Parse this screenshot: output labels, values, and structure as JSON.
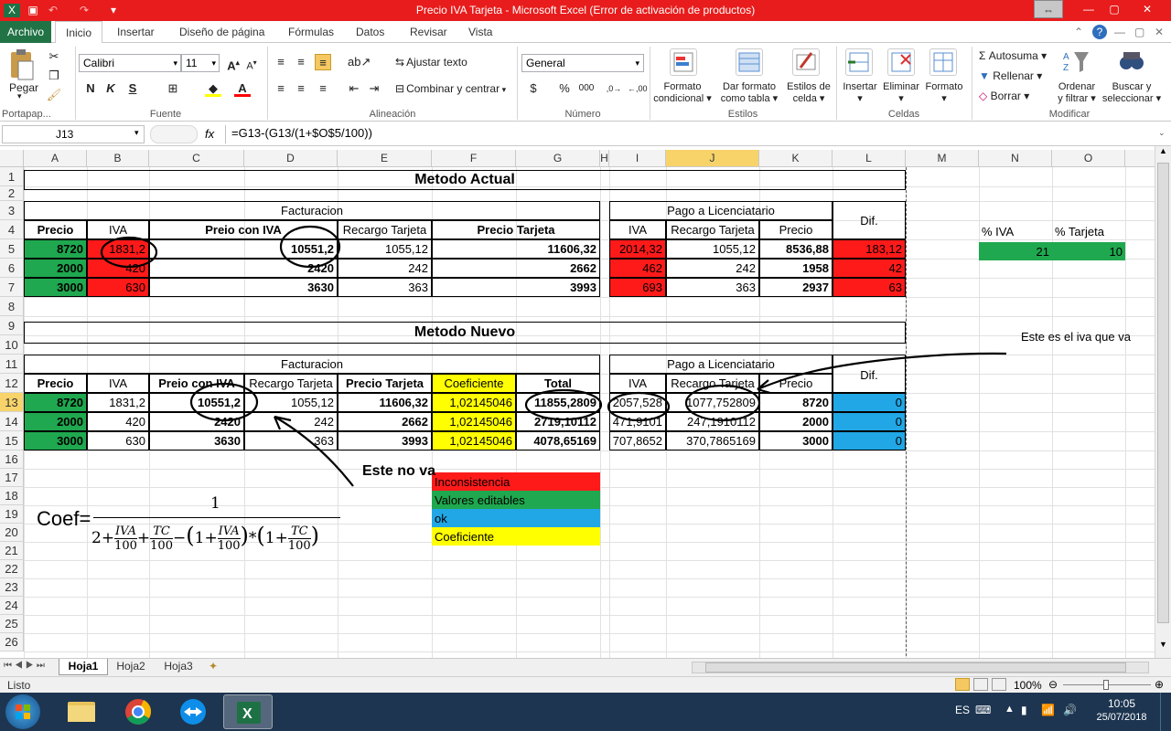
{
  "window": {
    "title": "Precio IVA Tarjeta - Microsoft Excel (Error de activación de productos)"
  },
  "ribbon_tabs": [
    "Archivo",
    "Inicio",
    "Insertar",
    "Diseño de página",
    "Fórmulas",
    "Datos",
    "Revisar",
    "Vista"
  ],
  "ribbon": {
    "pegar": "Pegar",
    "portapapeles": "Portapap...",
    "font_name": "Calibri",
    "font_size": "11",
    "fuente": "Fuente",
    "ajustar_texto": "Ajustar texto",
    "combinar": "Combinar y centrar",
    "alineacion": "Alineación",
    "number_format": "General",
    "numero": "Número",
    "formato_condicional": [
      "Formato",
      "condicional"
    ],
    "dar_formato": [
      "Dar formato",
      "como tabla"
    ],
    "estilos_celda": [
      "Estilos de",
      "celda"
    ],
    "estilos": "Estilos",
    "insertar": "Insertar",
    "eliminar": "Eliminar",
    "formato": "Formato",
    "celdas": "Celdas",
    "autosuma": "Autosuma",
    "rellenar": "Rellenar",
    "borrar": "Borrar",
    "ordenar": [
      "Ordenar",
      "y filtrar"
    ],
    "buscar": [
      "Buscar y",
      "seleccionar"
    ],
    "modificar": "Modificar"
  },
  "formula_bar": {
    "name_box": "J13",
    "fx": "fx",
    "formula": "=G13-(G13/(1+$O$5/100))"
  },
  "columns": [
    "A",
    "B",
    "C",
    "D",
    "E",
    "F",
    "G",
    "H",
    "I",
    "J",
    "K",
    "L",
    "M",
    "N",
    "O"
  ],
  "rows": [
    "1",
    "2",
    "3",
    "4",
    "5",
    "6",
    "7",
    "8",
    "9",
    "10",
    "11",
    "12",
    "13",
    "14",
    "15",
    "16",
    "17",
    "18",
    "19",
    "20",
    "21",
    "22",
    "23",
    "24",
    "25",
    "26"
  ],
  "sheet": {
    "titulo_actual": "Metodo Actual",
    "titulo_nuevo": "Metodo Nuevo",
    "facturacion": "Facturacion",
    "pago": "Pago a Licenciatario",
    "dif": "Dif.",
    "h_precio": "Precio",
    "h_iva": "IVA",
    "h_preio_iva": "Preio con IVA",
    "h_recargo": "Recargo Tarjeta",
    "h_precio_tarjeta": "Precio Tarjeta",
    "h_coef": "Coeficiente",
    "h_total": "Total",
    "pct_iva": "% IVA",
    "pct_tarjeta": "% Tarjeta",
    "val_iva": "21",
    "val_tarjeta": "10",
    "nota": "Este es el iva que va",
    "este_no_va": "Este no va",
    "actual_rows": [
      [
        "8720",
        "1831,2",
        "10551,2",
        "1055,12",
        "11606,32",
        "2014,32",
        "1055,12",
        "8536,88",
        "183,12"
      ],
      [
        "2000",
        "420",
        "2420",
        "242",
        "2662",
        "462",
        "242",
        "1958",
        "42"
      ],
      [
        "3000",
        "630",
        "3630",
        "363",
        "3993",
        "693",
        "363",
        "2937",
        "63"
      ]
    ],
    "nuevo_rows": [
      [
        "8720",
        "1831,2",
        "10551,2",
        "1055,12",
        "11606,32",
        "1,02145046",
        "11855,2809",
        "2057,528",
        "1077,752809",
        "8720",
        "0"
      ],
      [
        "2000",
        "420",
        "2420",
        "242",
        "2662",
        "1,02145046",
        "2719,10112",
        "471,9101",
        "247,1910112",
        "2000",
        "0"
      ],
      [
        "3000",
        "630",
        "3630",
        "363",
        "3993",
        "1,02145046",
        "4078,65169",
        "707,8652",
        "370,7865169",
        "3000",
        "0"
      ]
    ],
    "legend": [
      "Inconsistencia",
      "Valores editables",
      "ok",
      "Coeficiente"
    ],
    "formula": {
      "coef": "Coef=",
      "numerator": "1",
      "two": "2",
      "iva": "IVA",
      "tc": "TC",
      "hundred": "100",
      "one": "1"
    }
  },
  "sheet_tabs": [
    "Hoja1",
    "Hoja2",
    "Hoja3"
  ],
  "status": {
    "listo": "Listo",
    "zoom": "100%"
  },
  "taskbar": {
    "lang": "ES",
    "time": "10:05",
    "date": "25/07/2018"
  },
  "colors": {
    "title_red": "#e81c1c",
    "excel_green": "#217346",
    "cell_green": "#1fa84f",
    "cell_red": "#ff1a1a",
    "cell_yellow": "#ffff00",
    "cell_blue": "#21a7e6"
  }
}
